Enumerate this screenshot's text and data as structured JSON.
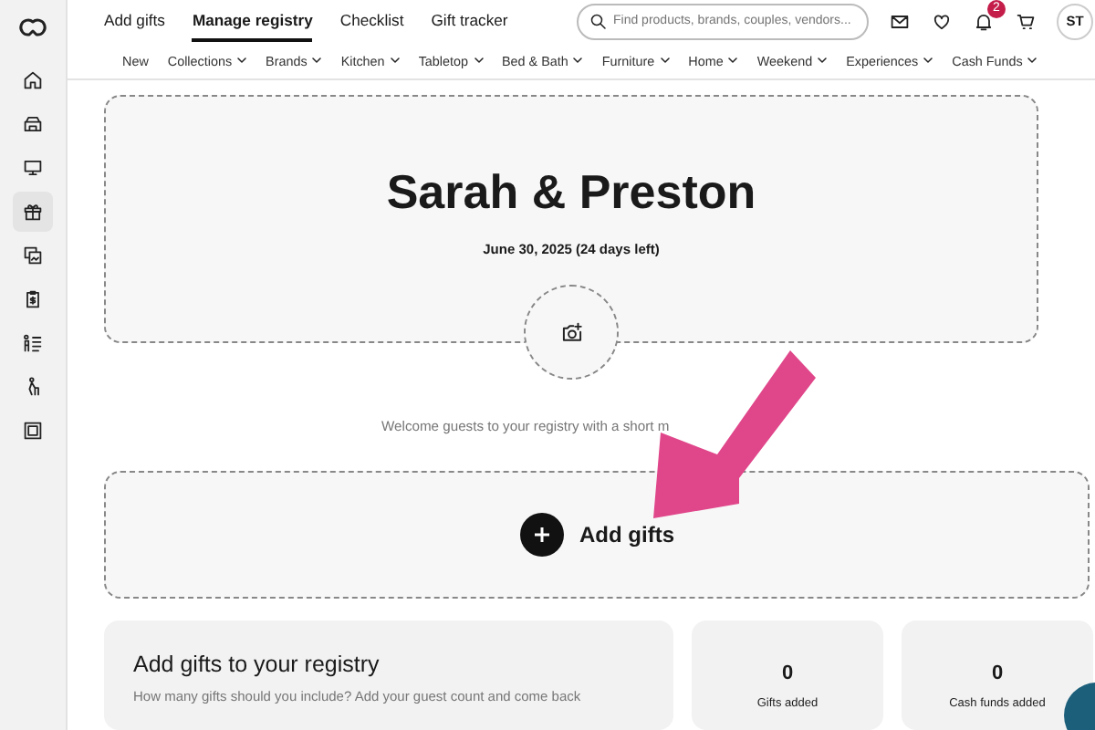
{
  "sidebar": {
    "items": [
      {
        "kind": "home",
        "selected": false
      },
      {
        "kind": "store",
        "selected": false
      },
      {
        "kind": "monitor",
        "selected": false
      },
      {
        "kind": "gift",
        "selected": true
      },
      {
        "kind": "photos",
        "selected": false
      },
      {
        "kind": "clipboard",
        "selected": false
      },
      {
        "kind": "checklist",
        "selected": false
      },
      {
        "kind": "walker",
        "selected": false
      },
      {
        "kind": "frame",
        "selected": false
      }
    ]
  },
  "tabs": [
    {
      "label": "Add gifts",
      "selected": false
    },
    {
      "label": "Manage registry",
      "selected": true
    },
    {
      "label": "Checklist",
      "selected": false
    },
    {
      "label": "Gift tracker",
      "selected": false
    }
  ],
  "search": {
    "placeholder": "Find products, brands, couples, vendors..."
  },
  "header_icons": [
    {
      "kind": "mail"
    },
    {
      "kind": "heart"
    },
    {
      "kind": "bell",
      "badge": "2"
    },
    {
      "kind": "cart"
    }
  ],
  "avatar": {
    "initials": "ST"
  },
  "categories": [
    {
      "label": "New",
      "dropdown": false
    },
    {
      "label": "Collections",
      "dropdown": true
    },
    {
      "label": "Brands",
      "dropdown": true
    },
    {
      "label": "Kitchen",
      "dropdown": true
    },
    {
      "label": "Tabletop",
      "dropdown": true
    },
    {
      "label": "Bed & Bath",
      "dropdown": true
    },
    {
      "label": "Furniture",
      "dropdown": true
    },
    {
      "label": "Home",
      "dropdown": true
    },
    {
      "label": "Weekend",
      "dropdown": true
    },
    {
      "label": "Experiences",
      "dropdown": true
    },
    {
      "label": "Cash Funds",
      "dropdown": true
    }
  ],
  "cover": {
    "names": "Sarah & Preston",
    "date": "June 30, 2025 (24 days left)"
  },
  "welcome": "Welcome guests to your registry with a short m",
  "add_gifts": {
    "label": "Add gifts"
  },
  "guide_card": {
    "title": "Add gifts to your registry",
    "text": "How many gifts should you include? Add your guest count and come back"
  },
  "stats": [
    {
      "value": "0",
      "label": "Gifts added"
    },
    {
      "value": "0",
      "label": "Cash funds added"
    }
  ]
}
